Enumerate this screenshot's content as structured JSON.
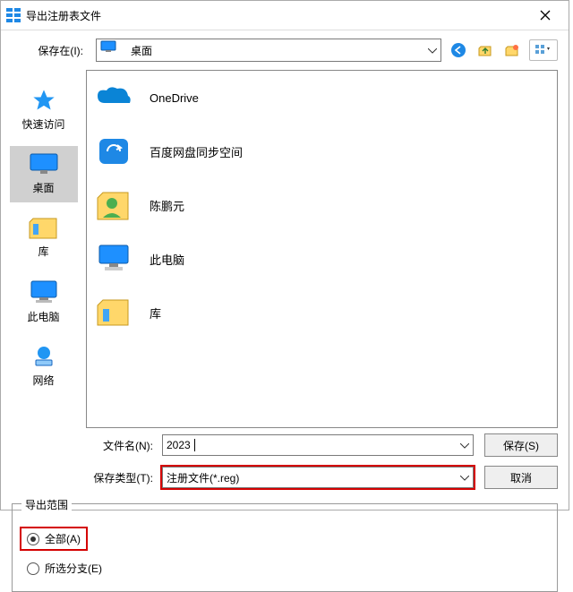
{
  "title": "导出注册表文件",
  "saveInLabel": "保存在(I):",
  "location": "桌面",
  "sidebar": [
    {
      "label": "快速访问"
    },
    {
      "label": "桌面"
    },
    {
      "label": "库"
    },
    {
      "label": "此电脑"
    },
    {
      "label": "网络"
    }
  ],
  "files": [
    {
      "name": "OneDrive"
    },
    {
      "name": "百度网盘同步空间"
    },
    {
      "name": "陈鹏元"
    },
    {
      "name": "此电脑"
    },
    {
      "name": "库"
    }
  ],
  "filenameLabel": "文件名(N):",
  "filenameValue": "2023",
  "filetypeLabel": "保存类型(T):",
  "filetypeValue": "注册文件(*.reg)",
  "saveBtn": "保存(S)",
  "cancelBtn": "取消",
  "exportRangeLegend": "导出范围",
  "radioAll": "全部(A)",
  "radioSelected": "所选分支(E)"
}
